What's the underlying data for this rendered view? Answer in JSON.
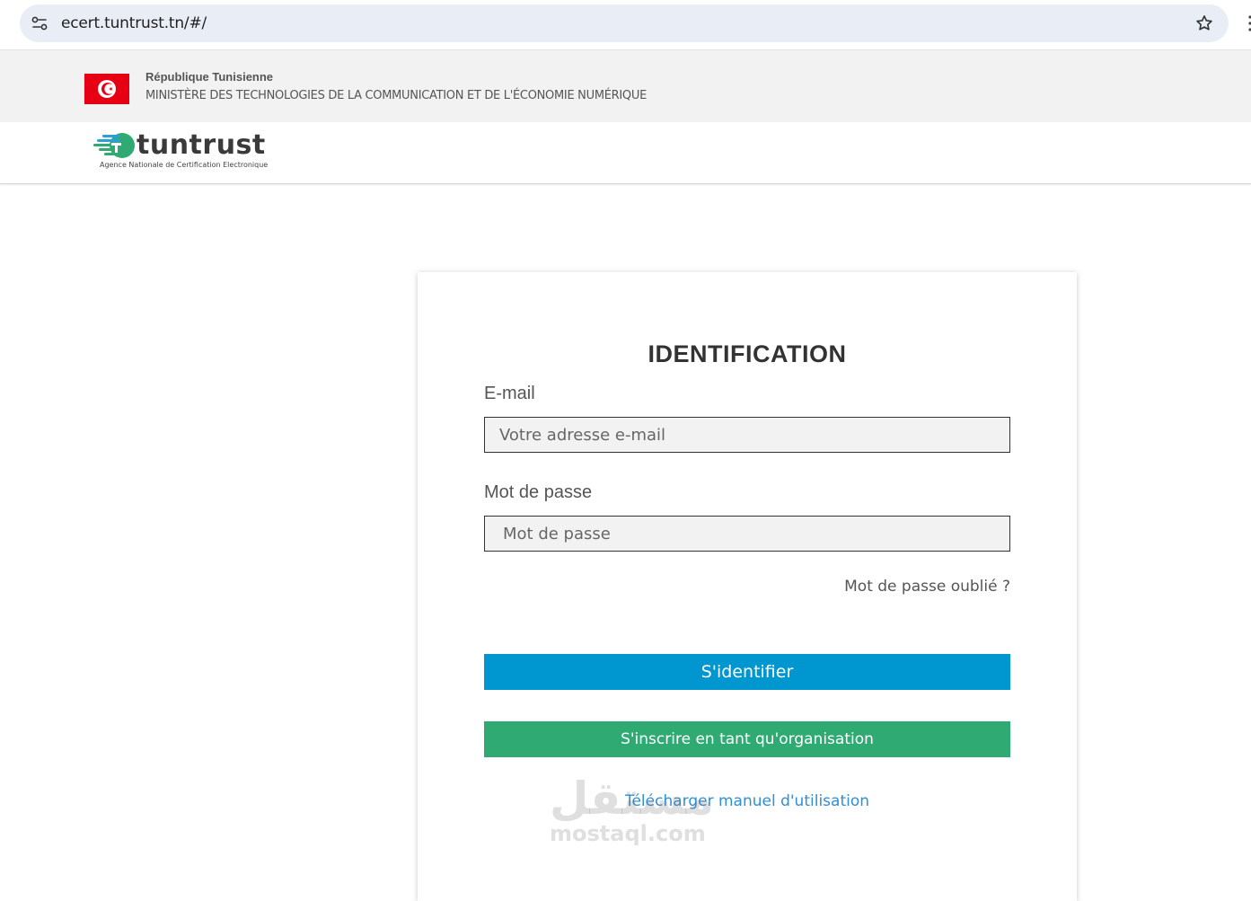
{
  "browser": {
    "url": "ecert.tuntrust.tn/#/"
  },
  "gov_header": {
    "country": "République Tunisienne",
    "ministry": "MINISTÈRE DES TECHNOLOGIES DE LA COMMUNICATION ET DE L'ÉCONOMIE NUMÉRIQUE",
    "flag_color": "#e70013"
  },
  "brand": {
    "name": "tuntrust",
    "tagline": "Agence Nationale de Certification Electronique",
    "accent_color": "#2eaa72"
  },
  "login": {
    "title": "IDENTIFICATION",
    "email_label": "E-mail",
    "email_placeholder": "Votre adresse e-mail",
    "password_label": "Mot de passe",
    "password_placeholder": "Mot de passe",
    "forgot_password": "Mot de passe oublié ?",
    "login_button": "S'identifier",
    "login_button_color": "#0096cf",
    "register_button": "S'inscrire en tant qu'organisation",
    "register_button_color": "#2eaa72",
    "manual_link": "Télécharger manuel d'utilisation"
  },
  "watermark": {
    "arabic": "مستقل",
    "latin": "mostaql.com"
  }
}
